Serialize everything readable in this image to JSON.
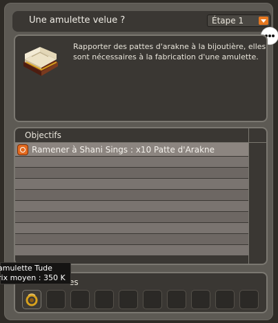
{
  "quest": {
    "title": "Une amulette velue ?",
    "step_label": "Étape 1",
    "description": "Rapporter des pattes d'arakne à la bijoutière, elles sont nécessaires à la fabrication d'une amulette."
  },
  "objectives": {
    "title": "Objectifs",
    "items": [
      {
        "text": "Ramener à Shani Sings : x10 Patte d'Arakne",
        "icon": "target-icon"
      }
    ]
  },
  "rewards": {
    "title": "es"
  },
  "tooltip": {
    "name": "amulette Tude",
    "price": "rix moyen : 350 K"
  },
  "icons": {
    "book": "book-icon",
    "chat": "chat-bubble-icon",
    "dropdown": "chevron-down-icon",
    "reward_item": "amulet-icon"
  },
  "colors": {
    "accent": "#e67820",
    "panel": "#3a3733",
    "frame": "#5d5a54"
  }
}
